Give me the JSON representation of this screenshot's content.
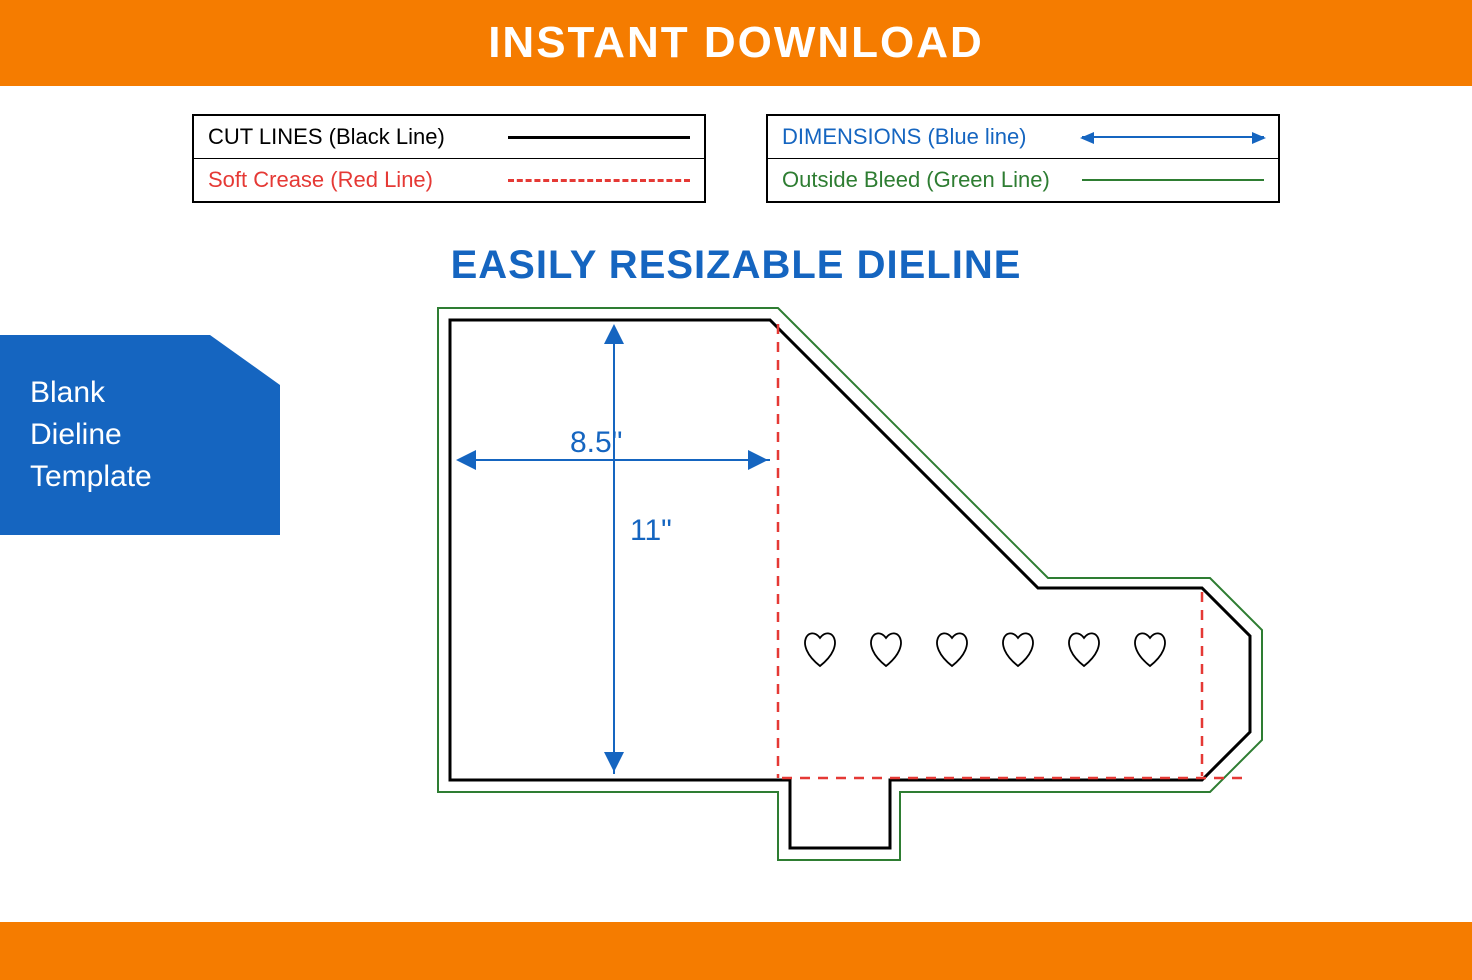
{
  "banner_top": "INSTANT DOWNLOAD",
  "subtitle": "EASILY RESIZABLE DIELINE",
  "side_tag": "Blank Dieline Template",
  "legend": {
    "cut": "CUT LINES (Black Line)",
    "crease": "Soft Crease (Red Line)",
    "dim": "DIMENSIONS (Blue line)",
    "bleed": "Outside Bleed (Green Line)"
  },
  "dims": {
    "width": "8.5\"",
    "height": "11\""
  },
  "colors": {
    "orange": "#f57c00",
    "blue": "#1565c0",
    "red": "#e53935",
    "green": "#2e7d32"
  },
  "hearts_count": 6
}
